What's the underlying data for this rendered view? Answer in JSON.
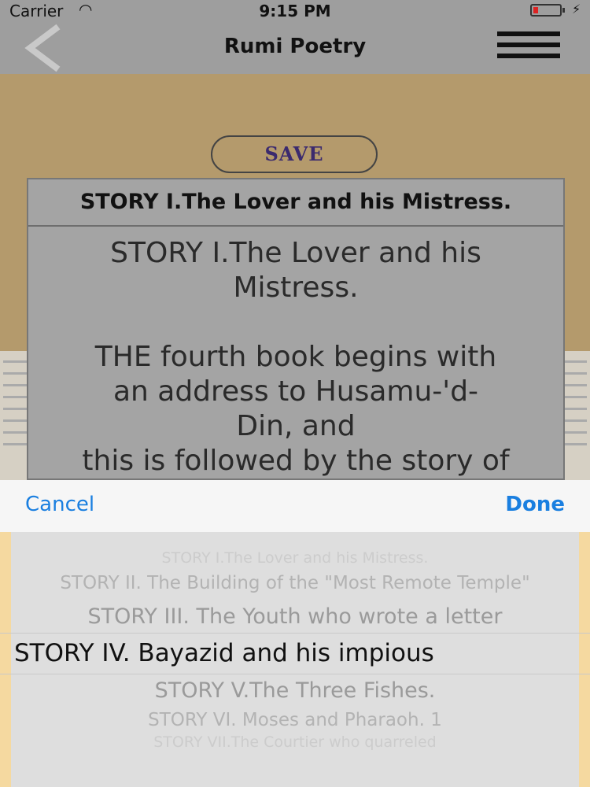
{
  "status": {
    "carrier": "Carrier",
    "time": "9:15 PM",
    "battery_level": 0.2
  },
  "nav": {
    "title": "Rumi Poetry"
  },
  "save_label": "SAVE",
  "story": {
    "title": "STORY I.The Lover and his Mistress.",
    "body": "STORY I.The Lover and his\nMistress.\n\nTHE fourth book begins with\nan address to Husamu-'d-\nDin, and\nthis is followed by the story of"
  },
  "picker": {
    "cancel_label": "Cancel",
    "done_label": "Done",
    "options": [
      "STORY I.The Lover and his Mistress.",
      "STORY II. The Building of the \"Most Remote Temple\"",
      "STORY III. The Youth who wrote a letter",
      "STORY IV. Bayazid and his impious",
      "STORY V.The Three Fishes.",
      "STORY VI. Moses and Pharaoh. 1",
      "STORY VII.The Courtier who quarreled"
    ],
    "selected_index": 3
  }
}
